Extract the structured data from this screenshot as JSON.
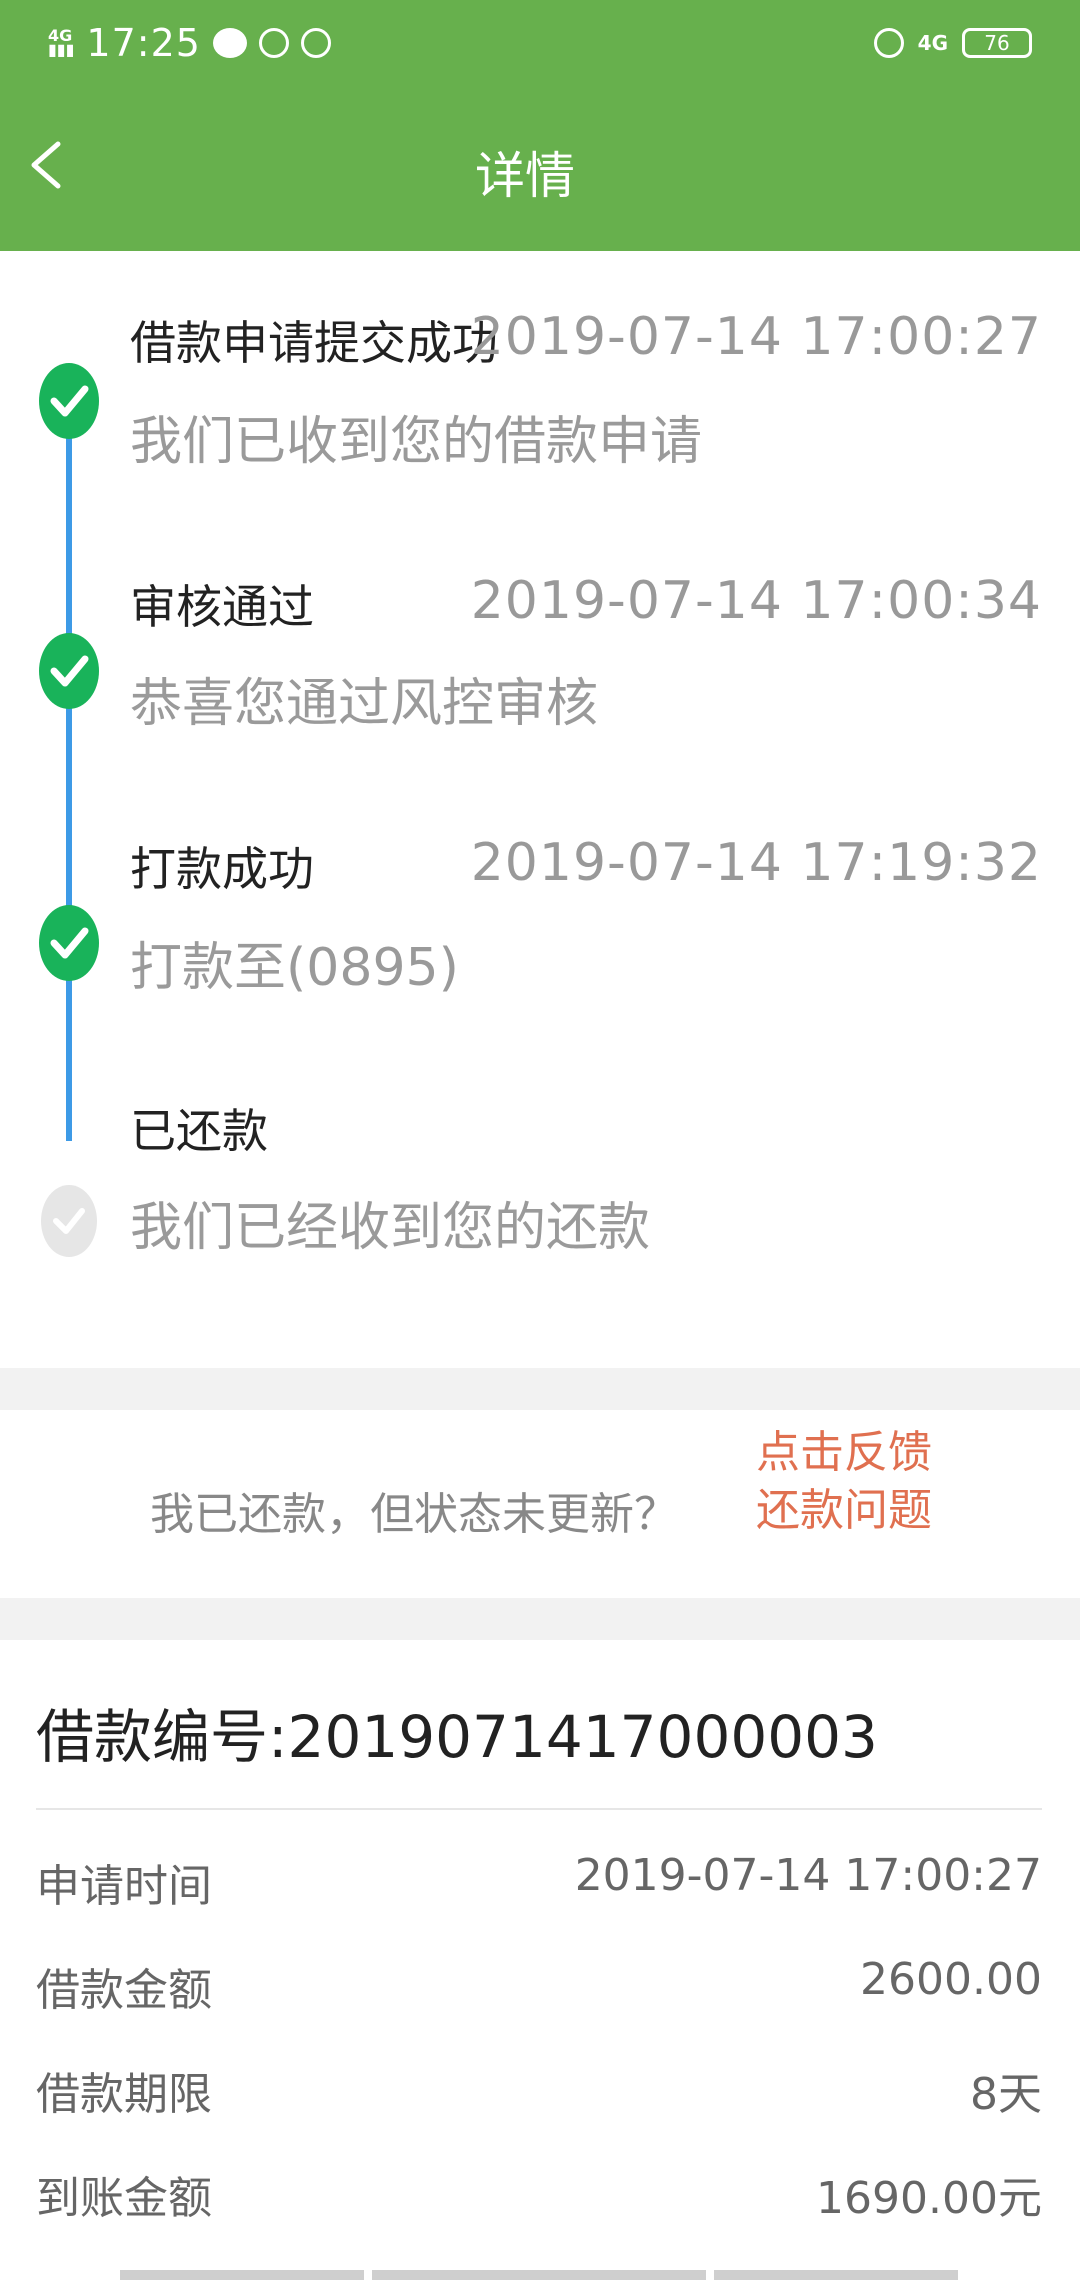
{
  "status_bar": {
    "network": "4G HD",
    "time": "17:25",
    "net_type": "4G",
    "battery": "76"
  },
  "header": {
    "title": "详情"
  },
  "timeline": [
    {
      "title": "借款申请提交成功",
      "time": "2019-07-14 17:00:27",
      "desc": "我们已收到您的借款申请",
      "done": true
    },
    {
      "title": "审核通过",
      "time": "2019-07-14 17:00:34",
      "desc": "恭喜您通过风控审核",
      "done": true
    },
    {
      "title": "打款成功",
      "time": "2019-07-14 17:19:32",
      "desc": "打款至(0895)",
      "done": true
    },
    {
      "title": "已还款",
      "time": "",
      "desc": "我们已经收到您的还款",
      "done": false
    }
  ],
  "feedback": {
    "text": "我已还款，但状态未更新？",
    "link": "点击反馈还款问题"
  },
  "loan": {
    "number_label": "借款编号:2019071417000003",
    "rows": [
      {
        "label": "申请时间",
        "value": "2019-07-14 17:00:27"
      },
      {
        "label": "借款金额",
        "value": "2600.00"
      },
      {
        "label": "借款期限",
        "value": "8天"
      },
      {
        "label": "到账金额",
        "value": "1690.00元"
      }
    ]
  },
  "colors": {
    "header_green": "#67b04d",
    "check_green": "#19b35a",
    "timeline_blue": "#3d9ae6",
    "link_orange": "#e07050"
  }
}
